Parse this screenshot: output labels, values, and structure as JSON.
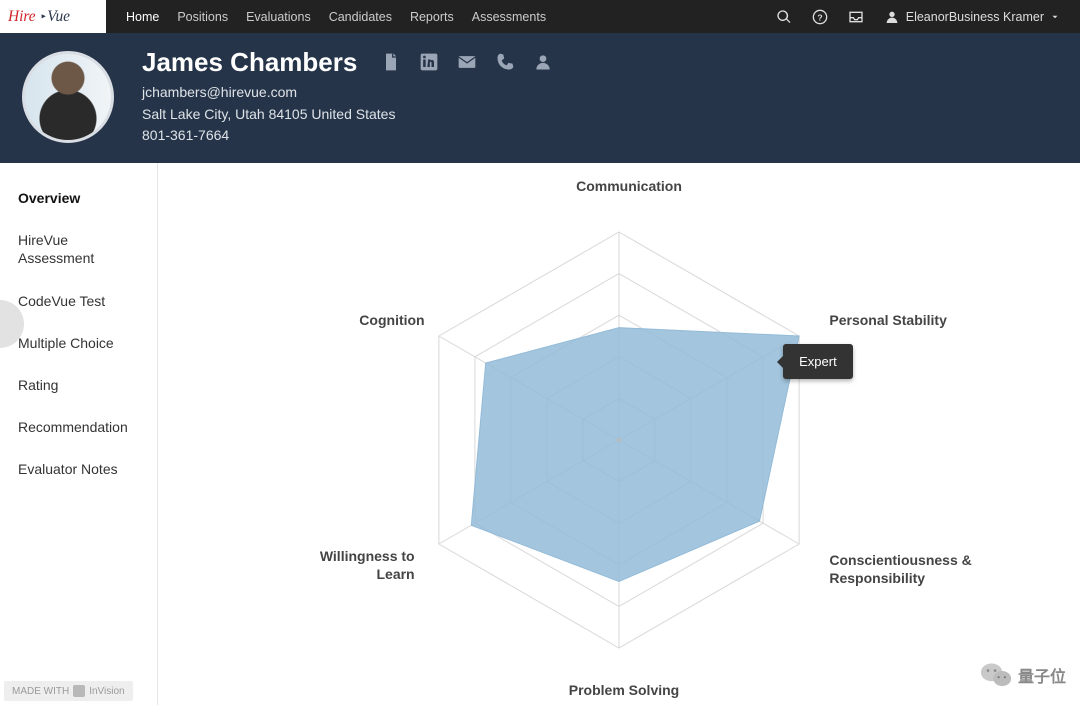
{
  "brand": {
    "name": "HireVue"
  },
  "nav": {
    "items": [
      "Home",
      "Positions",
      "Evaluations",
      "Candidates",
      "Reports",
      "Assessments"
    ],
    "active": 0
  },
  "topright": {
    "user_label": "EleanorBusiness Kramer"
  },
  "candidate": {
    "name": "James Chambers",
    "email": "jchambers@hirevue.com",
    "location": "Salt Lake City, Utah 84105 United States",
    "phone": "801-361-7664"
  },
  "sidebar": {
    "items": [
      "Overview",
      "HireVue Assessment",
      "CodeVue Test",
      "Multiple Choice",
      "Rating",
      "Recommendation",
      "Evaluator Notes"
    ],
    "active": 0
  },
  "tooltip": {
    "label": "Expert"
  },
  "watermark": {
    "madewith": "MADE WITH",
    "tool": "InVision"
  },
  "overlay": {
    "wechat_label": "量子位"
  },
  "chart_data": {
    "type": "radar",
    "title": "",
    "scale_max": 5,
    "tooltip": {
      "axis_index": 1,
      "text": "Expert"
    },
    "axes": [
      {
        "label": "Communication",
        "value": 2.7
      },
      {
        "label": "Personal Stability",
        "value": 5.0
      },
      {
        "label": "Conscientiousness & Responsibility",
        "value": 3.9
      },
      {
        "label": "Problem Solving",
        "value": 3.4
      },
      {
        "label": "Willingness to Learn",
        "value": 4.1
      },
      {
        "label": "Cognition",
        "value": 3.7
      }
    ],
    "fill_color": "#93bbd8",
    "grid_color": "#d8d8d8",
    "rings": 5
  }
}
